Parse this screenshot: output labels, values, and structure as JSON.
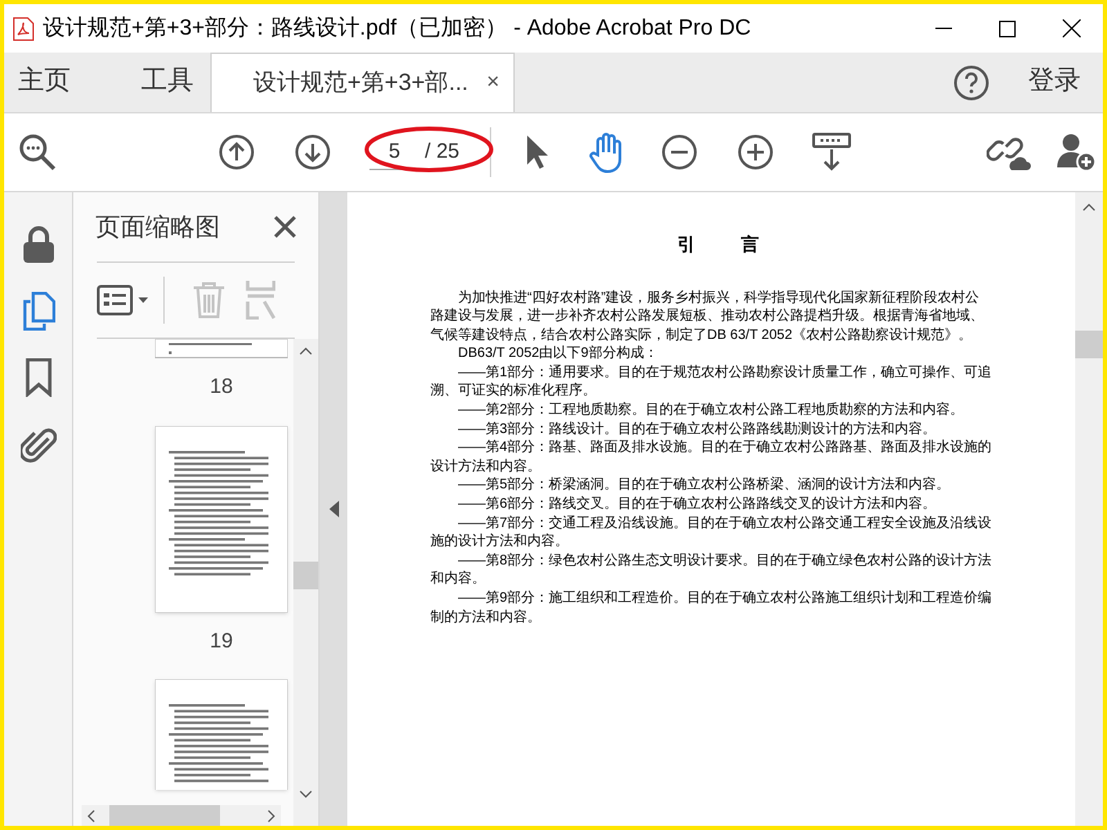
{
  "window": {
    "title": "设计规范+第+3+部分：路线设计.pdf（已加密） - Adobe Acrobat Pro DC"
  },
  "nav_tabs": [
    {
      "label": "主页",
      "selected": false
    },
    {
      "label": "工具",
      "selected": false
    }
  ],
  "doc_tab": {
    "label": "设计规范+第+3+部...",
    "selected": true,
    "close": "×"
  },
  "login": "登录",
  "toolbar": {
    "page_number": "5",
    "page_total": "/ 25",
    "hand_tool_selected": true
  },
  "sidebar": {
    "items": [
      {
        "kind": "lock",
        "selected": false
      },
      {
        "kind": "pages",
        "selected": true
      },
      {
        "kind": "bookmark",
        "selected": false
      },
      {
        "kind": "attachment",
        "selected": false
      }
    ]
  },
  "thumbnails": {
    "title": "页面缩略图",
    "pages": [
      {
        "kind": "cut",
        "label": "18"
      },
      {
        "kind": "full",
        "label": "19"
      },
      {
        "kind": "partial"
      }
    ]
  },
  "document": {
    "heading": "引　言",
    "paragraphs": [
      "为加快推进“四好农村路”建设，服务乡村振兴，科学指导现代化国家新征程阶段农村公路建设与发展，进一步补齐农村公路发展短板、推动农村公路提档升级。根据青海省地域、气候等建设特点，结合农村公路实际，制定了DB 63/T 2052《农村公路勘察设计规范》。",
      "DB63/T 2052由以下9部分构成：",
      "——第1部分：通用要求。目的在于规范农村公路勘察设计质量工作，确立可操作、可追溯、可证实的标准化程序。",
      "——第2部分：工程地质勘察。目的在于确立农村公路工程地质勘察的方法和内容。",
      "——第3部分：路线设计。目的在于确立农村公路路线勘测设计的方法和内容。",
      "——第4部分：路基、路面及排水设施。目的在于确立农村公路路基、路面及排水设施的设计方法和内容。",
      "——第5部分：桥梁涵洞。目的在于确立农村公路桥梁、涵洞的设计方法和内容。",
      "——第6部分：路线交叉。目的在于确立农村公路路线交叉的设计方法和内容。",
      "——第7部分：交通工程及沿线设施。目的在于确立农村公路交通工程安全设施及沿线设施的设计方法和内容。",
      "——第8部分：绿色农村公路生态文明设计要求。目的在于确立绿色农村公路的设计方法和内容。",
      "——第9部分：施工组织和工程造价。目的在于确立农村公路施工组织计划和工程造价编制的方法和内容。"
    ]
  }
}
